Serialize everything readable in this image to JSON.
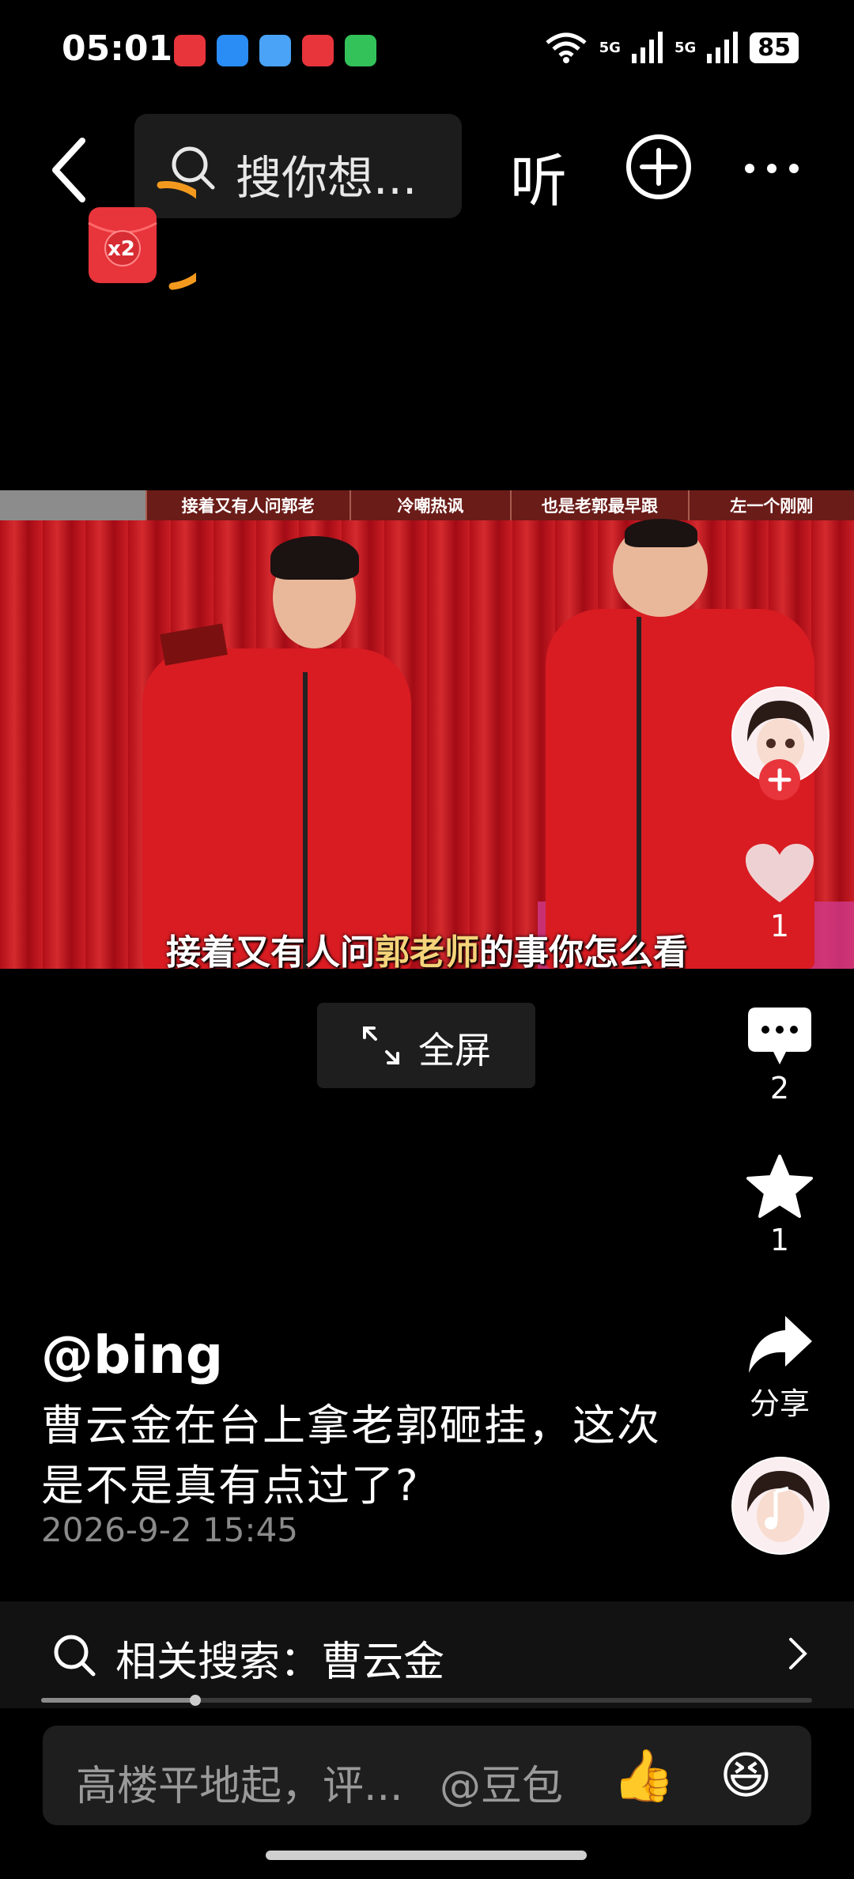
{
  "status_bar": {
    "time": "05:01",
    "network_1": "5G",
    "network_2": "5G",
    "battery": "85"
  },
  "top_bar": {
    "search_placeholder": "搜你想...",
    "listen_label": "听"
  },
  "red_packet": {
    "label": "x2"
  },
  "video": {
    "top_segments": [
      "接着又有人问郭老",
      "冷嘲热讽",
      "也是老郭最早跟",
      "左一个刚刚"
    ],
    "subtitle_before": "接着又有人问",
    "subtitle_highlight": "郭老师",
    "subtitle_after": "的事你怎么看"
  },
  "fullscreen_label": "全屏",
  "rail": {
    "likes": "1",
    "comments": "2",
    "favorites": "1",
    "share_label": "分享"
  },
  "post": {
    "author": "@bing",
    "description": "曹云金在台上拿老郭砸挂，这次是不是真有点过了?",
    "timestamp": "2026-9-2 15:45"
  },
  "related_search": {
    "label": "相关搜索：曹云金"
  },
  "playback": {
    "progress_fraction": 0.2
  },
  "comment_bar": {
    "placeholder": "高楼平地起，评...",
    "mention": "@豆包",
    "emoji_1": "👍",
    "emoji_2": "😆"
  },
  "colors": {
    "accent_red": "#e8343b",
    "arc_orange": "#f39a1e",
    "highlight_yellow": "#f4d37a"
  }
}
